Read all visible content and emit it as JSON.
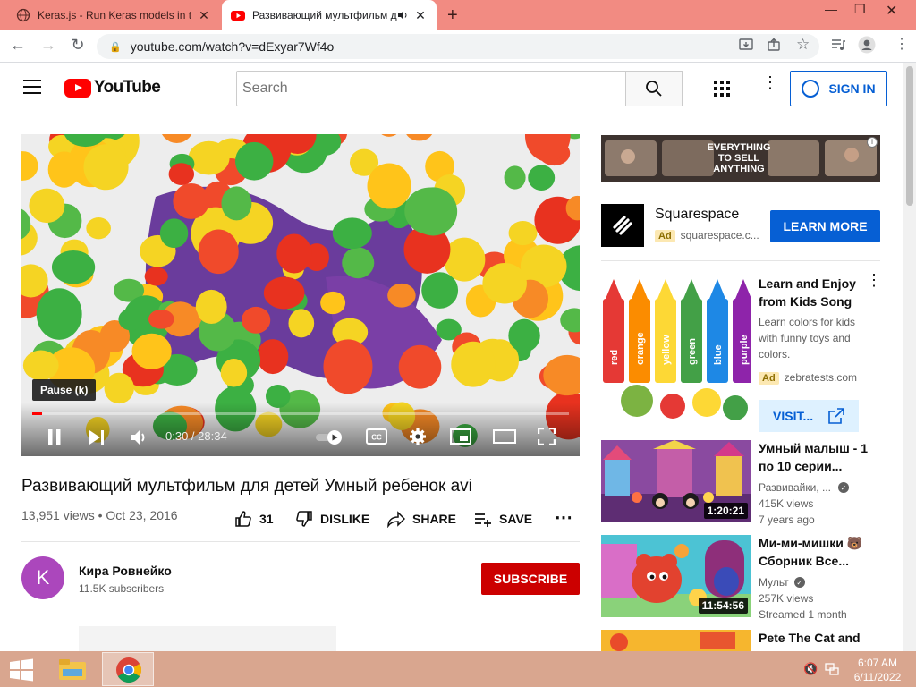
{
  "browser": {
    "tabs": [
      {
        "title": "Keras.js - Run Keras models in th",
        "active": false
      },
      {
        "title": "Развивающий мультфильм д",
        "active": true
      }
    ],
    "url": "youtube.com/watch?v=dExyar7Wf4o",
    "new_tab_icon": "+"
  },
  "youtube": {
    "logo_text": "YouTube",
    "search_placeholder": "Search",
    "sign_in": "SIGN IN"
  },
  "player": {
    "tooltip": "Pause (k)",
    "time": "0:30 / 28:34",
    "progress": 0.0175
  },
  "video": {
    "title": "Развивающий мультфильм для детей Умный ребенок avi",
    "meta": "13,951 views • Oct 23, 2016",
    "likes": "31",
    "dislike": "DISLIKE",
    "share": "SHARE",
    "save": "SAVE"
  },
  "channel": {
    "initial": "K",
    "name": "Кира Ровнейко",
    "subscribers": "11.5K subscribers",
    "subscribe": "SUBSCRIBE"
  },
  "sidebar": {
    "banner_text": "EVERYTHING TO SELL ANYTHING",
    "squarespace": {
      "name": "Squarespace",
      "ad": "Ad",
      "domain": "squarespace.c...",
      "cta": "LEARN MORE"
    },
    "ad_video": {
      "title": "Learn and Enjoy from Kids Song",
      "desc": "Learn colors for kids with funny toys and colors.",
      "ad": "Ad",
      "domain": "zebratests.com",
      "cta": "VISIT...",
      "crayons": [
        "red",
        "orange",
        "yellow",
        "green",
        "blue",
        "purple"
      ]
    },
    "videos": [
      {
        "title": "Умный малыш - 1 по 10 серии...",
        "channel": "Развивайки, ...",
        "views": "415K views",
        "age": "7 years ago",
        "duration": "1:20:21"
      },
      {
        "title": "Ми-ми-мишки 🐻 Сборник Все...",
        "channel": "Мульт",
        "views": "257K views",
        "age": "Streamed 1 month",
        "duration": "11:54:56"
      },
      {
        "title": "Pete The Cat and",
        "channel": "",
        "views": "",
        "age": "",
        "duration": ""
      }
    ]
  },
  "taskbar": {
    "time": "6:07 AM",
    "date": "6/11/2022"
  },
  "colors": {
    "tabbar": "#f28b82",
    "yt_red": "#ff0000",
    "blue": "#065fd4",
    "subscribe": "#cc0000",
    "taskbar": "#d9a68f"
  }
}
